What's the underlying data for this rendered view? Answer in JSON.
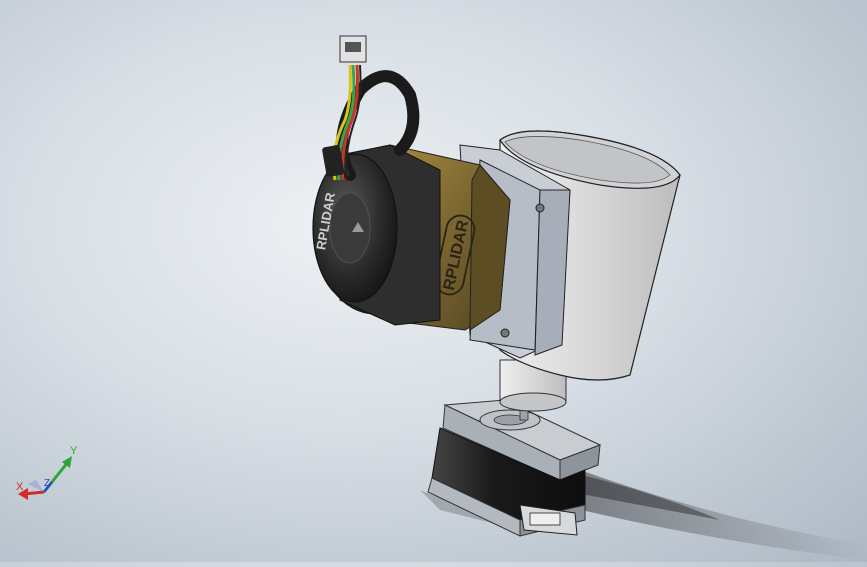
{
  "viewport": {
    "background": "gradient-grey-blue"
  },
  "model": {
    "lidar_label": "RPLIDAR",
    "lidar_body_color": "#7a6530",
    "lidar_cap_color": "#202020",
    "mount_color": "#c8cdd6",
    "cylinder_color": "#d7d9dc",
    "stepper_color": "#1c1c1c",
    "wires": [
      "#d8c21a",
      "#3aa64a",
      "#c7342a",
      "#222222"
    ]
  },
  "triad": {
    "x_label": "X",
    "y_label": "Y",
    "z_label": "Z",
    "x_color": "#d12a2a",
    "y_color": "#2aa636",
    "z_color": "#2a3ed1"
  }
}
